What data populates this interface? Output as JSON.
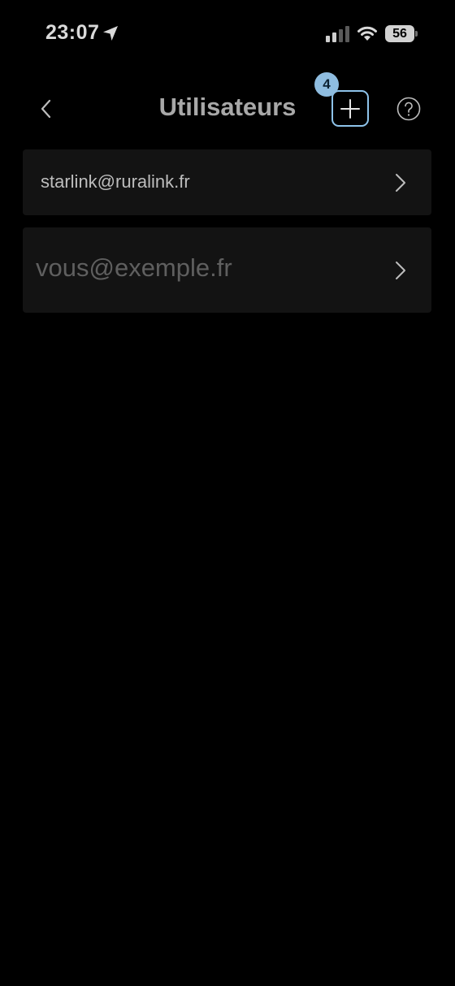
{
  "status_bar": {
    "time": "23:07",
    "battery": "56",
    "icons": [
      "location-arrow-icon",
      "cellular-signal-icon",
      "wifi-icon",
      "battery-icon"
    ]
  },
  "header": {
    "title": "Utilisateurs",
    "badge": "4",
    "icons": [
      "back-chevron-icon",
      "plus-icon",
      "help-circle-icon"
    ],
    "accent_color": "#8ec3ea"
  },
  "users": {
    "existing_email": "starlink@ruralink.fr",
    "new_email_placeholder": "vous@exemple.fr"
  }
}
